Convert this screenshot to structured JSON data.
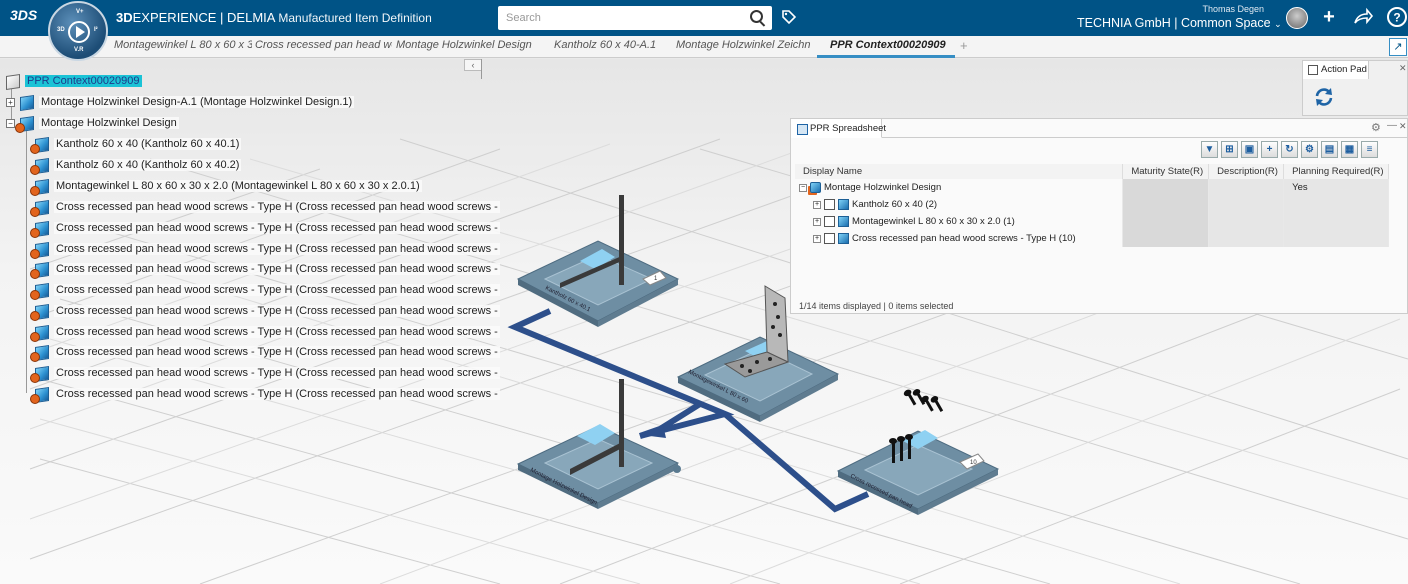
{
  "topbar": {
    "logo": "3DS",
    "compass_labels": {
      "top": "V+",
      "left": "3D",
      "right": "I²",
      "bottom": "V.R"
    },
    "brand_bold": "3D",
    "brand_rest": "EXPERIENCE | DELMIA",
    "module": "Manufactured Item Definition",
    "search_placeholder": "Search",
    "user_name": "Thomas Degen",
    "workspace": "TECHNIA GmbH | Common Space",
    "icons": [
      "compass-icon",
      "search-icon",
      "tag-icon",
      "avatar",
      "add-icon",
      "share-icon",
      "help-icon"
    ]
  },
  "tabs": [
    {
      "label": "Montagewinkel L 80 x 60 x 3"
    },
    {
      "label": "Cross recessed pan head wo"
    },
    {
      "label": "Montage Holzwinkel Design"
    },
    {
      "label": "Kantholz 60 x 40-A.1"
    },
    {
      "label": "Montage Holzwinkel Zeichn"
    },
    {
      "label": "PPR Context00020909"
    }
  ],
  "active_tab": "PPR Context00020909",
  "tree": {
    "root": "PPR Context00020909",
    "nodes": [
      {
        "label": "Montage Holzwinkel Design-A.1 (Montage Holzwinkel Design.1)"
      },
      {
        "label": "Montage Holzwinkel Design"
      },
      {
        "label": "Kantholz 60 x 40 (Kantholz 60 x 40.1)"
      },
      {
        "label": "Kantholz 60 x 40 (Kantholz 60 x 40.2)"
      },
      {
        "label": "Montagewinkel L 80 x 60 x 30 x 2.0 (Montagewinkel L 80 x 60 x 30 x 2.0.1)"
      },
      {
        "label": "Cross recessed pan head wood screws - Type H (Cross recessed pan head wood screws -"
      },
      {
        "label": "Cross recessed pan head wood screws - Type H (Cross recessed pan head wood screws -"
      },
      {
        "label": "Cross recessed pan head wood screws - Type H (Cross recessed pan head wood screws -"
      },
      {
        "label": "Cross recessed pan head wood screws - Type H (Cross recessed pan head wood screws -"
      },
      {
        "label": "Cross recessed pan head wood screws - Type H (Cross recessed pan head wood screws -"
      },
      {
        "label": "Cross recessed pan head wood screws - Type H (Cross recessed pan head wood screws -"
      },
      {
        "label": "Cross recessed pan head wood screws - Type H (Cross recessed pan head wood screws -"
      },
      {
        "label": "Cross recessed pan head wood screws - Type H (Cross recessed pan head wood screws -"
      },
      {
        "label": "Cross recessed pan head wood screws - Type H (Cross recessed pan head wood screws -"
      },
      {
        "label": "Cross recessed pan head wood screws - Type H (Cross recessed pan head wood screws -"
      }
    ]
  },
  "action_pad": {
    "title": "Action Pad"
  },
  "spreadsheet": {
    "title": "PPR Spreadsheet",
    "columns": [
      "Display Name",
      "Maturity State(R)",
      "Description(R)",
      "Planning Required(R)"
    ],
    "rows": [
      {
        "name": "Montage Holzwinkel Design",
        "maturity": "",
        "description": "",
        "planning": "Yes"
      },
      {
        "name": "Kantholz 60 x 40 (2)",
        "maturity": "",
        "description": "",
        "planning": ""
      },
      {
        "name": "Montagewinkel L 80 x 60 x 30 x 2.0 (1)",
        "maturity": "",
        "description": "",
        "planning": ""
      },
      {
        "name": "Cross recessed pan head wood screws - Type H (10)",
        "maturity": "",
        "description": "",
        "planning": ""
      }
    ],
    "status": "1/14 items displayed | 0 items selected"
  },
  "scene": {
    "boards": [
      {
        "label": "Kantholz 60 x 40.1",
        "badge": "1"
      },
      {
        "label": "Montagewinkel L 80 x 60",
        "badge": ""
      },
      {
        "label": "Montage Holzwinkel Design",
        "badge": ""
      },
      {
        "label": "Cross recessed pan head",
        "badge": "10"
      }
    ]
  },
  "colors": {
    "topbar": "#005386",
    "accent": "#368ec4",
    "flow_line": "#2d4f8b",
    "board": "#6e8ea3",
    "selection": "#1ac3d6"
  }
}
